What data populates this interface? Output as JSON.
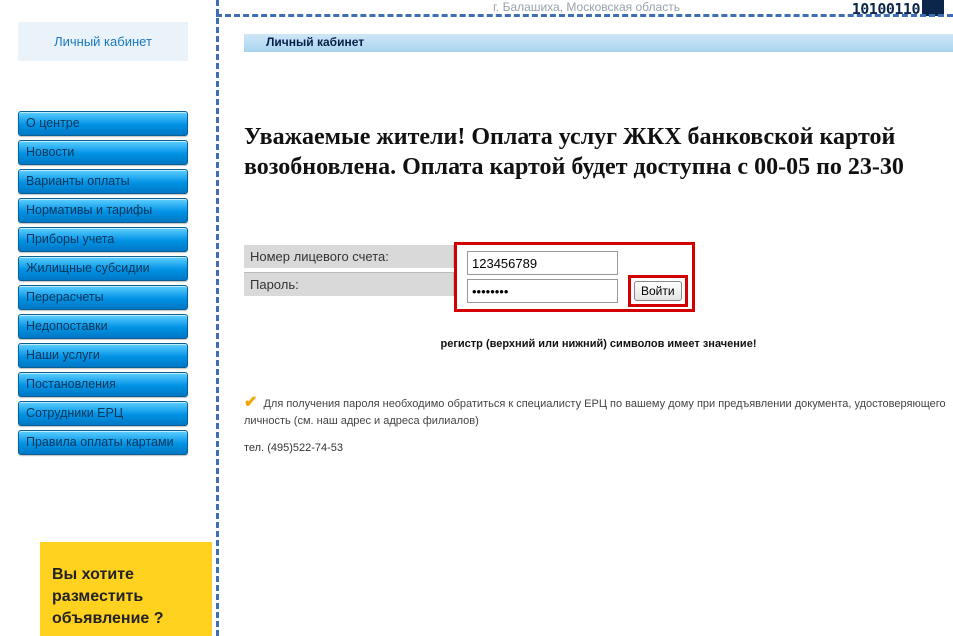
{
  "top_location": "г. Балашиха, Московская область",
  "barcode_text": "10100110",
  "sidebar": {
    "lk_title": "Личный кабинет",
    "items": [
      "О центре",
      "Новости",
      "Варианты оплаты",
      "Нормативы и тарифы",
      "Приборы учета",
      "Жилищные субсидии",
      "Перерасчеты",
      "Недопоставки",
      "Наши услуги",
      "Постановления",
      "Сотрудники ЕРЦ",
      "Правила оплаты картами"
    ]
  },
  "ad": {
    "line1": "Вы хотите",
    "line2": "разместить",
    "line3": "объявление ?"
  },
  "content": {
    "stripe_label": "Личный кабинет",
    "headline": "Уважаемые жители! Оплата услуг ЖКХ банковской картой возобновлена. Оплата картой будет доступна с 00-05 по 23-30",
    "form": {
      "account_label": "Номер лицевого счета:",
      "account_value": "123456789",
      "password_label": "Пароль:",
      "password_value": "••••••••",
      "submit": "Войти"
    },
    "case_note": "регистр (верхний или нижний) символов имеет значение!",
    "info_note": "Для получения пароля необходимо обратиться к специалисту ЕРЦ по вашему дому при предъявлении документа, удостоверяющего личность (см. наш адрес и адреса филиалов)",
    "phone": "тел. (495)522-74-53"
  }
}
